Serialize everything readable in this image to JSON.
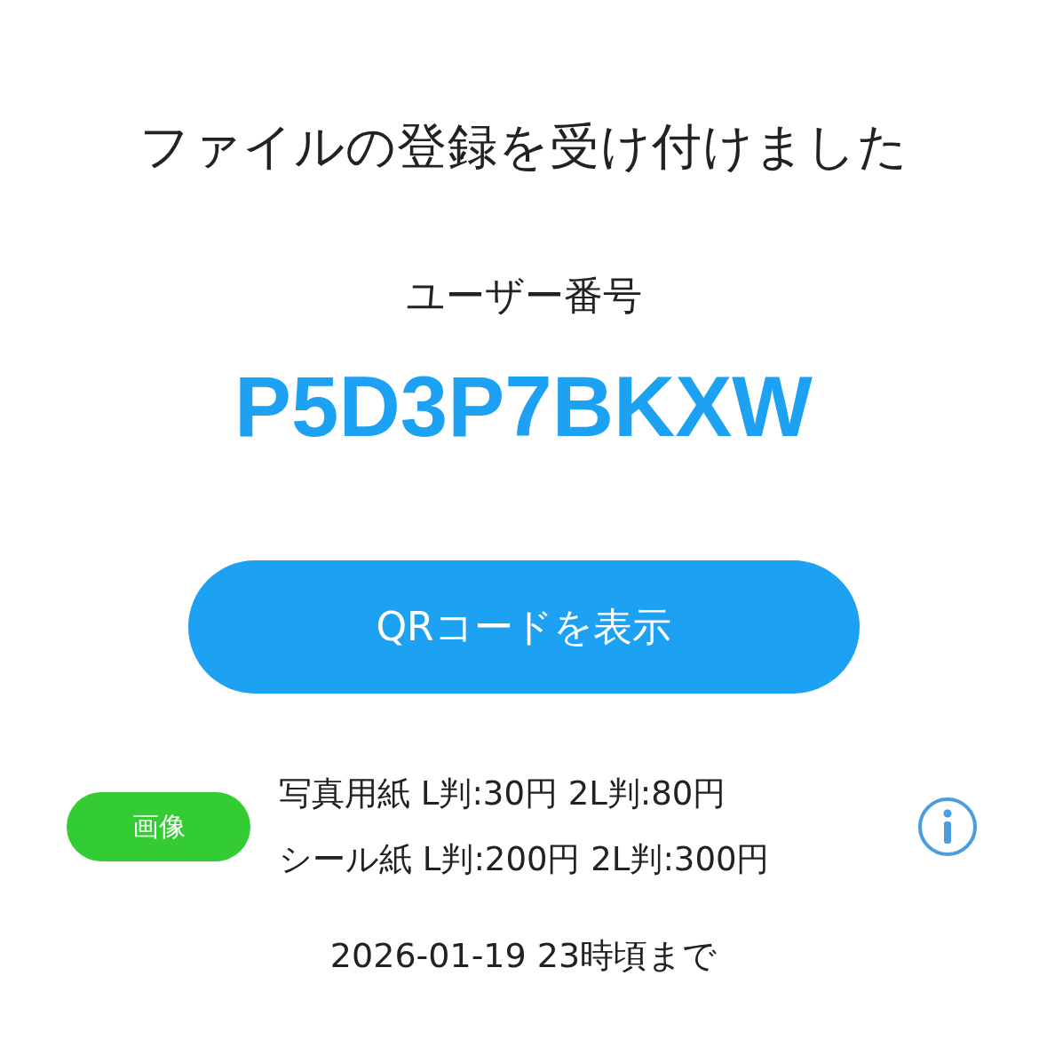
{
  "title": "ファイルの登録を受け付けました",
  "user_number": {
    "label": "ユーザー番号",
    "value": "P5D3P7BKXW"
  },
  "qr_button": {
    "label": "QRコードを表示"
  },
  "pricing": {
    "badge": {
      "label": "画像",
      "color": "#33cc33"
    },
    "lines": [
      "写真用紙 L判:30円 2L判:80円",
      "シール紙 L判:200円 2L判:300円"
    ]
  },
  "deadline": "2026-01-19 23時頃まで"
}
